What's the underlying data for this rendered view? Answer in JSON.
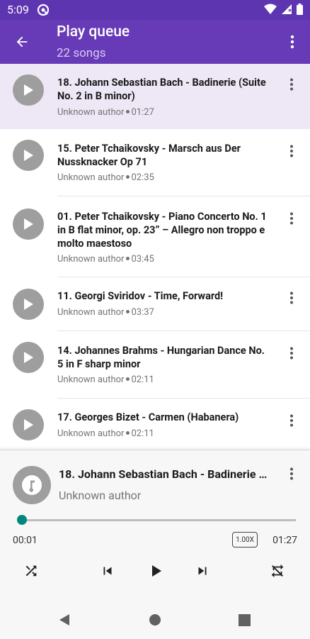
{
  "status_bar": {
    "time": "5:09"
  },
  "app_bar": {
    "title": "Play queue",
    "subtitle": "22 songs"
  },
  "queue": [
    {
      "title": "18. Johann Sebastian Bach - Badinerie (Suite No. 2 in B minor)",
      "author": "Unknown author",
      "duration": "01:27",
      "active": true
    },
    {
      "title": "15. Peter Tchaikovsky - Marsch aus Der Nussknacker Op 71",
      "author": "Unknown author",
      "duration": "02:35",
      "active": false
    },
    {
      "title": "01. Peter Tchaikovsky - Piano Concerto No. 1 in B flat minor, op. 23” – Allegro non troppo e molto maestoso",
      "author": "Unknown author",
      "duration": "03:45",
      "active": false
    },
    {
      "title": "11. Georgi Sviridov - Time, Forward!",
      "author": "Unknown author",
      "duration": "03:37",
      "active": false
    },
    {
      "title": "14. Johannes Brahms - Hungarian Dance No. 5 in F sharp minor",
      "author": "Unknown author",
      "duration": "02:11",
      "active": false
    },
    {
      "title": "17. Georges Bizet - Carmen (Habanera)",
      "author": "Unknown author",
      "duration": "02:11",
      "active": false
    }
  ],
  "now_playing": {
    "title": "18. Johann Sebastian Bach - Badinerie (Suite No. 2 in B minor)",
    "artist": "Unknown author",
    "current_time": "00:01",
    "total_time": "01:27",
    "progress": 0.01,
    "speed": "1.00X"
  },
  "colors": {
    "primary": "#673ab7",
    "primary_dark": "#5e35b1",
    "accent": "#00897b",
    "active_row": "#ede7f6"
  }
}
